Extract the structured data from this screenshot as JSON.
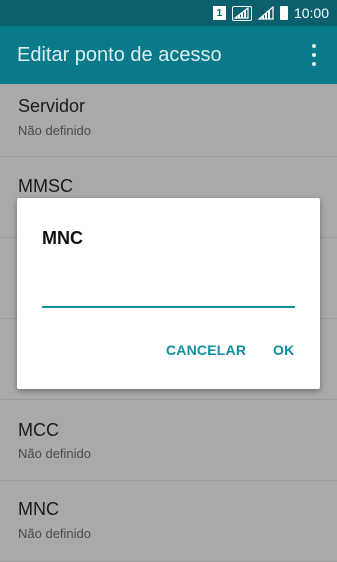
{
  "status_bar": {
    "sim_label": "1",
    "time": "10:00"
  },
  "toolbar": {
    "title": "Editar ponto de acesso",
    "menu_icon": "more-vert-icon"
  },
  "list": [
    {
      "name": "Servidor",
      "value": "Não definido"
    },
    {
      "name": "MMSC",
      "value": ""
    },
    {
      "name": "MCC",
      "value": "Não definido"
    },
    {
      "name": "MNC",
      "value": "Não definido"
    }
  ],
  "dialog": {
    "title": "MNC",
    "input_value": "",
    "cancel_label": "CANCELAR",
    "ok_label": "OK"
  },
  "colors": {
    "status_bar": "#0c5f6c",
    "toolbar": "#087a89",
    "accent": "#0d93a6"
  }
}
